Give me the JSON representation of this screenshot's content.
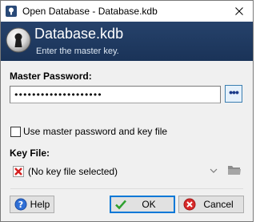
{
  "window": {
    "title": "Open Database - Database.kdb"
  },
  "banner": {
    "title": "Database.kdb",
    "subtitle": "Enter the master key."
  },
  "master_password": {
    "label": "Master Password:",
    "value": "••••••••••••••••••••",
    "toggle_label": "•••"
  },
  "key_file_option": {
    "label": "Use master password and key file",
    "checked": false
  },
  "key_file": {
    "label": "Key File:",
    "selected": "(No key file selected)"
  },
  "buttons": {
    "help": "Help",
    "ok": "OK",
    "cancel": "Cancel"
  },
  "colors": {
    "banner": "#26426b",
    "accent": "#0078d7"
  }
}
